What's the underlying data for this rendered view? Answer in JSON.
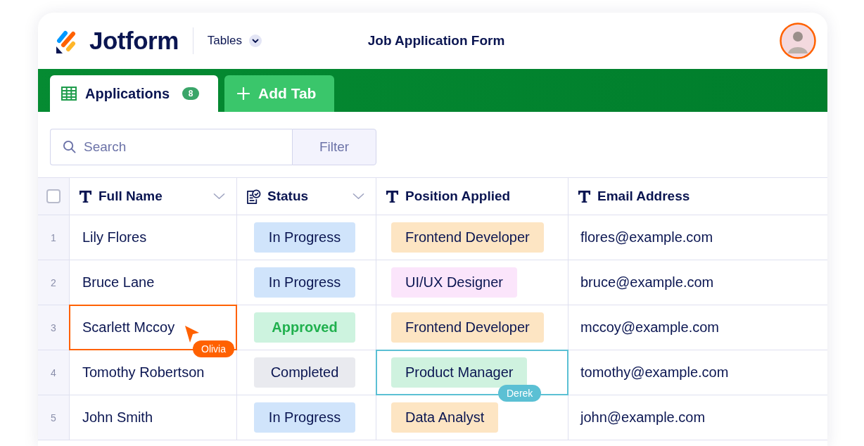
{
  "header": {
    "brand": "Jotform",
    "menu": "Tables",
    "title": "Job Application Form"
  },
  "tabs": [
    {
      "label": "Applications",
      "count": "8",
      "selected": true
    }
  ],
  "add_tab": "Add Tab",
  "toolbar": {
    "search": {
      "placeholder": "Search"
    },
    "filter": "Filter"
  },
  "table": {
    "select_all": {
      "checked": false
    },
    "columns": [
      {
        "label": "Full Name",
        "kind": "text",
        "dropdown": true
      },
      {
        "label": "Status",
        "kind": "status",
        "dropdown": true
      },
      {
        "label": "Position Applied",
        "kind": "text",
        "dropdown": false
      },
      {
        "label": "Email Address",
        "kind": "text",
        "dropdown": false
      }
    ],
    "rows": [
      {
        "number": "1",
        "name": "Lily Flores",
        "status": {
          "label": "In Progress",
          "color": "#d0e4fb",
          "emphasis": false
        },
        "position": {
          "label": "Frontend Developer",
          "color": "#fde5c3"
        },
        "email": "flores@example.com"
      },
      {
        "number": "2",
        "name": "Bruce Lane",
        "status": {
          "label": "In Progress",
          "color": "#d0e4fb",
          "emphasis": false
        },
        "position": {
          "label": "UI/UX Designer",
          "color": "#fbe5fb"
        },
        "email": "bruce@example.com"
      },
      {
        "number": "3",
        "name": "Scarlett Mccoy",
        "name_editor": {
          "name": "Olivia",
          "color": "#ff6100",
          "pointer": true
        },
        "status": {
          "label": "Approved",
          "color": "#cdf3df",
          "emphasis": true
        },
        "position": {
          "label": "Frontend Developer",
          "color": "#fde5c3"
        },
        "email": "mccoy@example.com"
      },
      {
        "number": "4",
        "name": "Tomothy Robertson",
        "status": {
          "label": "Completed",
          "color": "#e9eaef",
          "emphasis": false
        },
        "position": {
          "label": "Product Manager",
          "color": "#cff2df"
        },
        "position_editor": {
          "name": "Derek",
          "color": "#5bc0d4",
          "pointer": false
        },
        "email": "tomothy@example.com"
      },
      {
        "number": "5",
        "name": "John Smith",
        "status": {
          "label": "In Progress",
          "color": "#d0e4fb",
          "emphasis": false
        },
        "position": {
          "label": "Data Analyst",
          "color": "#fde5c3"
        },
        "email": "john@example.com"
      }
    ]
  }
}
